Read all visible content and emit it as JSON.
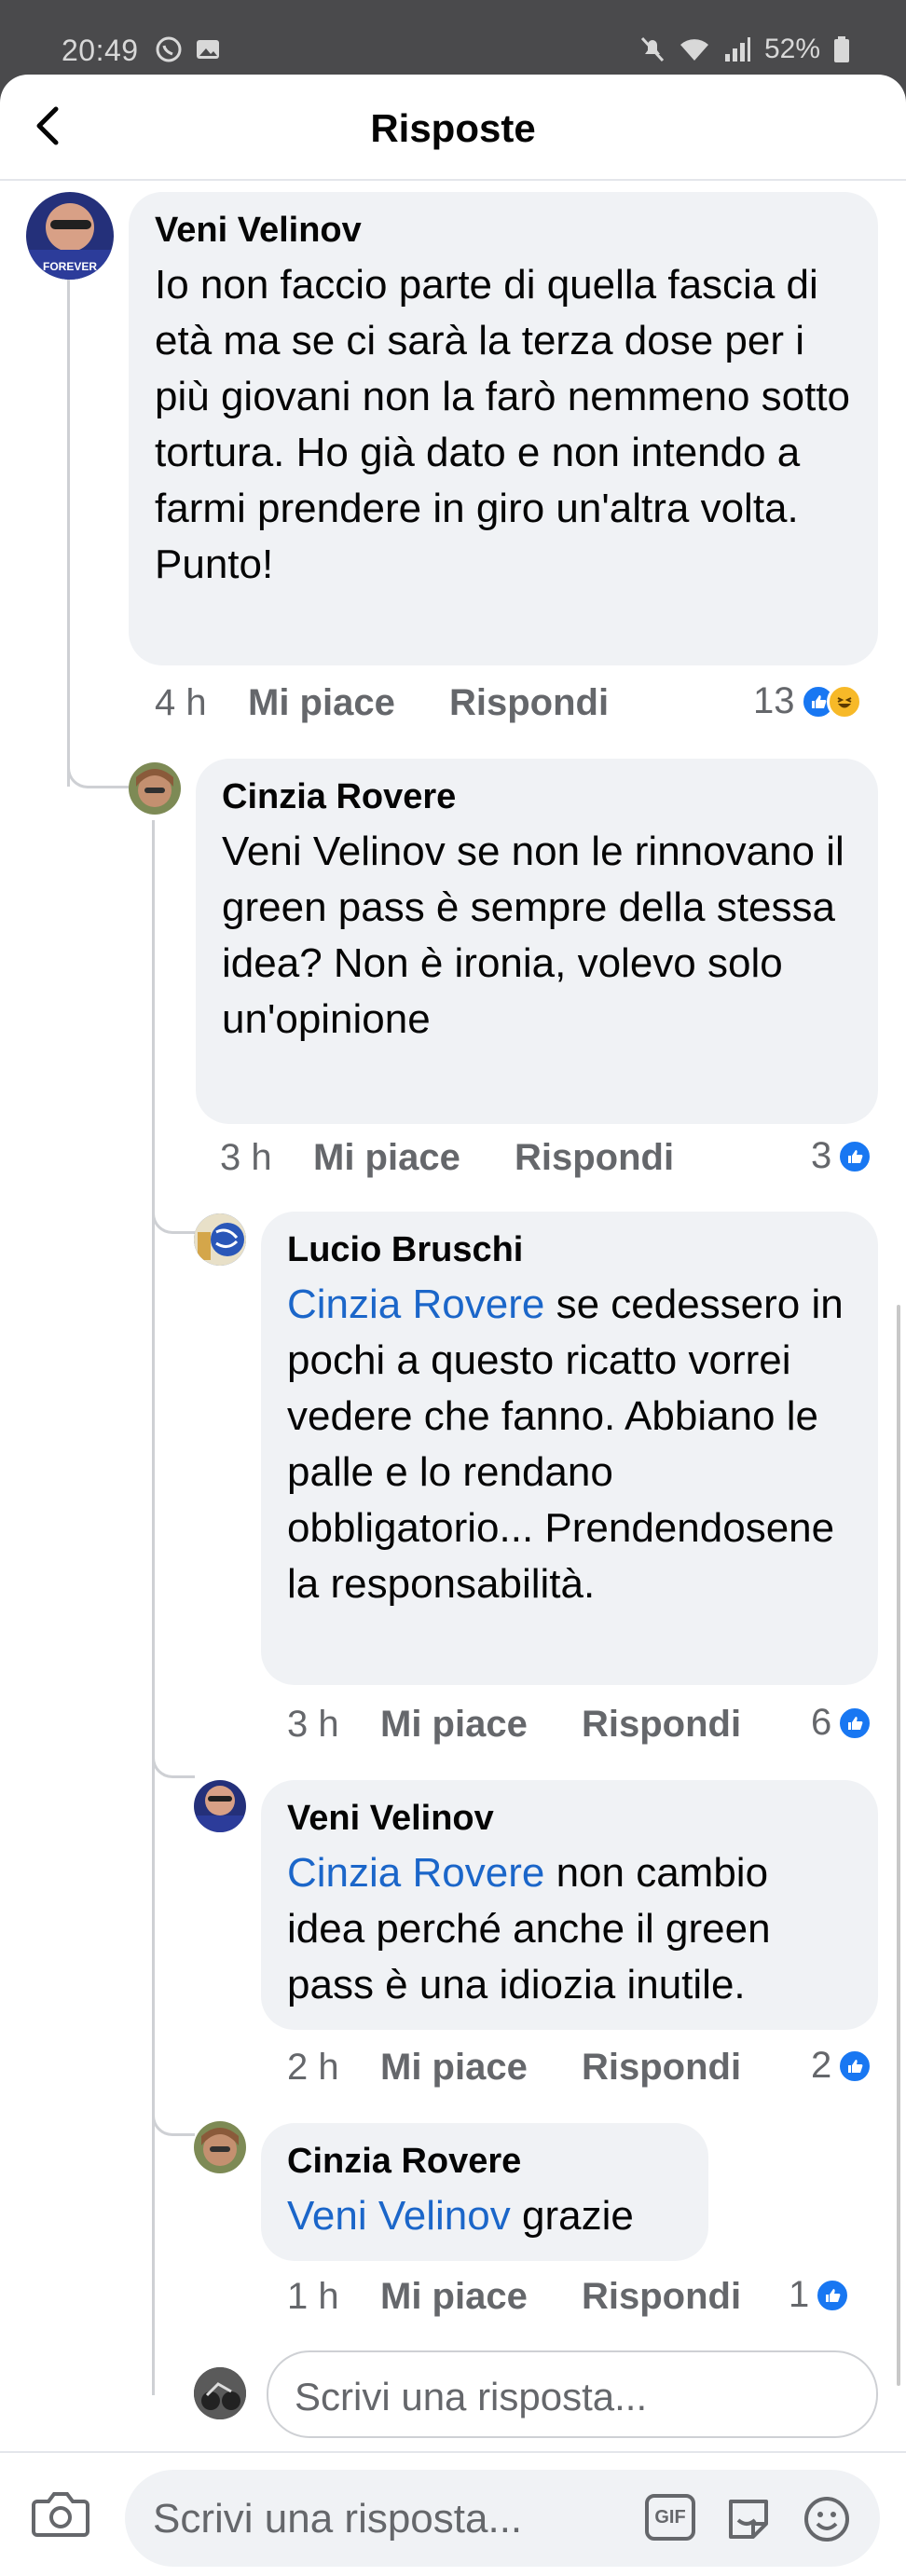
{
  "status_bar": {
    "time": "20:49",
    "battery": "52%"
  },
  "header": {
    "title": "Risposte"
  },
  "comments": [
    {
      "author": "Veni Velinov",
      "text": "Io non faccio parte di quella fascia di età ma se ci sarà la terza dose per i più giovani non la farò nemmeno sotto tortura. Ho già dato e non intendo a farmi prendere in giro un'altra volta. Punto!",
      "time": "4 h",
      "like_label": "Mi piace",
      "reply_label": "Rispondi",
      "reactions": "13"
    },
    {
      "author": "Cinzia Rovere",
      "text": "Veni Velinov se non le rinnovano il green pass è sempre della stessa idea? Non è ironia, volevo solo un'opinione",
      "time": "3 h",
      "like_label": "Mi piace",
      "reply_label": "Rispondi",
      "reactions": "3"
    },
    {
      "author": "Lucio Bruschi",
      "mention": "Cinzia Rovere",
      "text": " se cedessero in pochi a questo ricatto vorrei vedere che fanno. Abbiano le palle e lo rendano obbligatorio... Prendendosene la responsabilità.",
      "time": "3 h",
      "like_label": "Mi piace",
      "reply_label": "Rispondi",
      "reactions": "6"
    },
    {
      "author": "Veni Velinov",
      "mention": "Cinzia Rovere",
      "text": " non cambio idea perché anche il green pass è una idiozia inutile.",
      "time": "2 h",
      "like_label": "Mi piace",
      "reply_label": "Rispondi",
      "reactions": "2"
    },
    {
      "author": "Cinzia Rovere",
      "mention": "Veni Velinov",
      "text": " grazie",
      "time": "1 h",
      "like_label": "Mi piace",
      "reply_label": "Rispondi",
      "reactions": "1"
    }
  ],
  "reply_box": {
    "placeholder": "Scrivi una risposta..."
  },
  "bottom_bar": {
    "placeholder": "Scrivi una risposta...",
    "gif_label": "GIF"
  },
  "icons": [
    "back-arrow-icon",
    "camera-icon",
    "gif-icon",
    "sticker-icon",
    "emoji-icon",
    "like-reaction-icon",
    "haha-reaction-icon"
  ],
  "colors": {
    "mention": "#1b66c9",
    "like": "#1877f2",
    "bubble": "#f0f2f5"
  }
}
